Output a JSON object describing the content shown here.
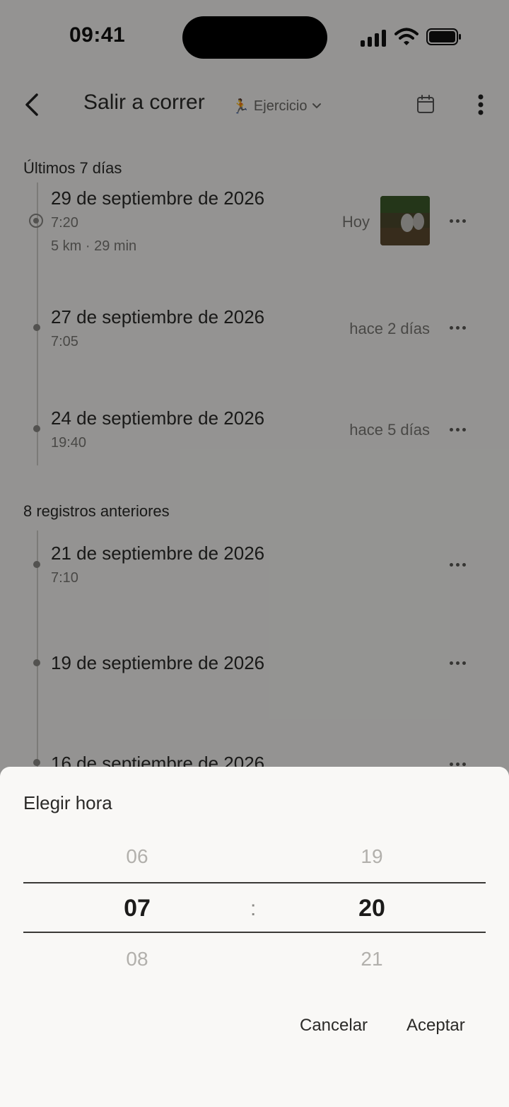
{
  "status_bar": {
    "time": "09:41"
  },
  "header": {
    "title": "Salir a correr",
    "category": "Ejercicio"
  },
  "sections": [
    {
      "label": "Últimos 7 días"
    },
    {
      "label": "8 registros anteriores"
    }
  ],
  "entries": [
    {
      "date": "29 de septiembre de 2026",
      "time": "7:20",
      "details": "5 km · 29 min",
      "relative": "Hoy"
    },
    {
      "date": "27 de septiembre de 2026",
      "time": "7:05",
      "relative": "hace 2 días"
    },
    {
      "date": "24 de septiembre de 2026",
      "time": "19:40",
      "relative": "hace 5 días"
    },
    {
      "date": "21 de septiembre de 2026",
      "time": "7:10"
    },
    {
      "date": "19 de septiembre de 2026"
    },
    {
      "date": "16 de septiembre de 2026"
    }
  ],
  "time_picker": {
    "title": "Elegir hora",
    "hours": {
      "prev": "06",
      "selected": "07",
      "next": "08"
    },
    "separator": ":",
    "minutes": {
      "prev": "19",
      "selected": "20",
      "next": "21"
    },
    "cancel_label": "Cancelar",
    "accept_label": "Aceptar"
  }
}
